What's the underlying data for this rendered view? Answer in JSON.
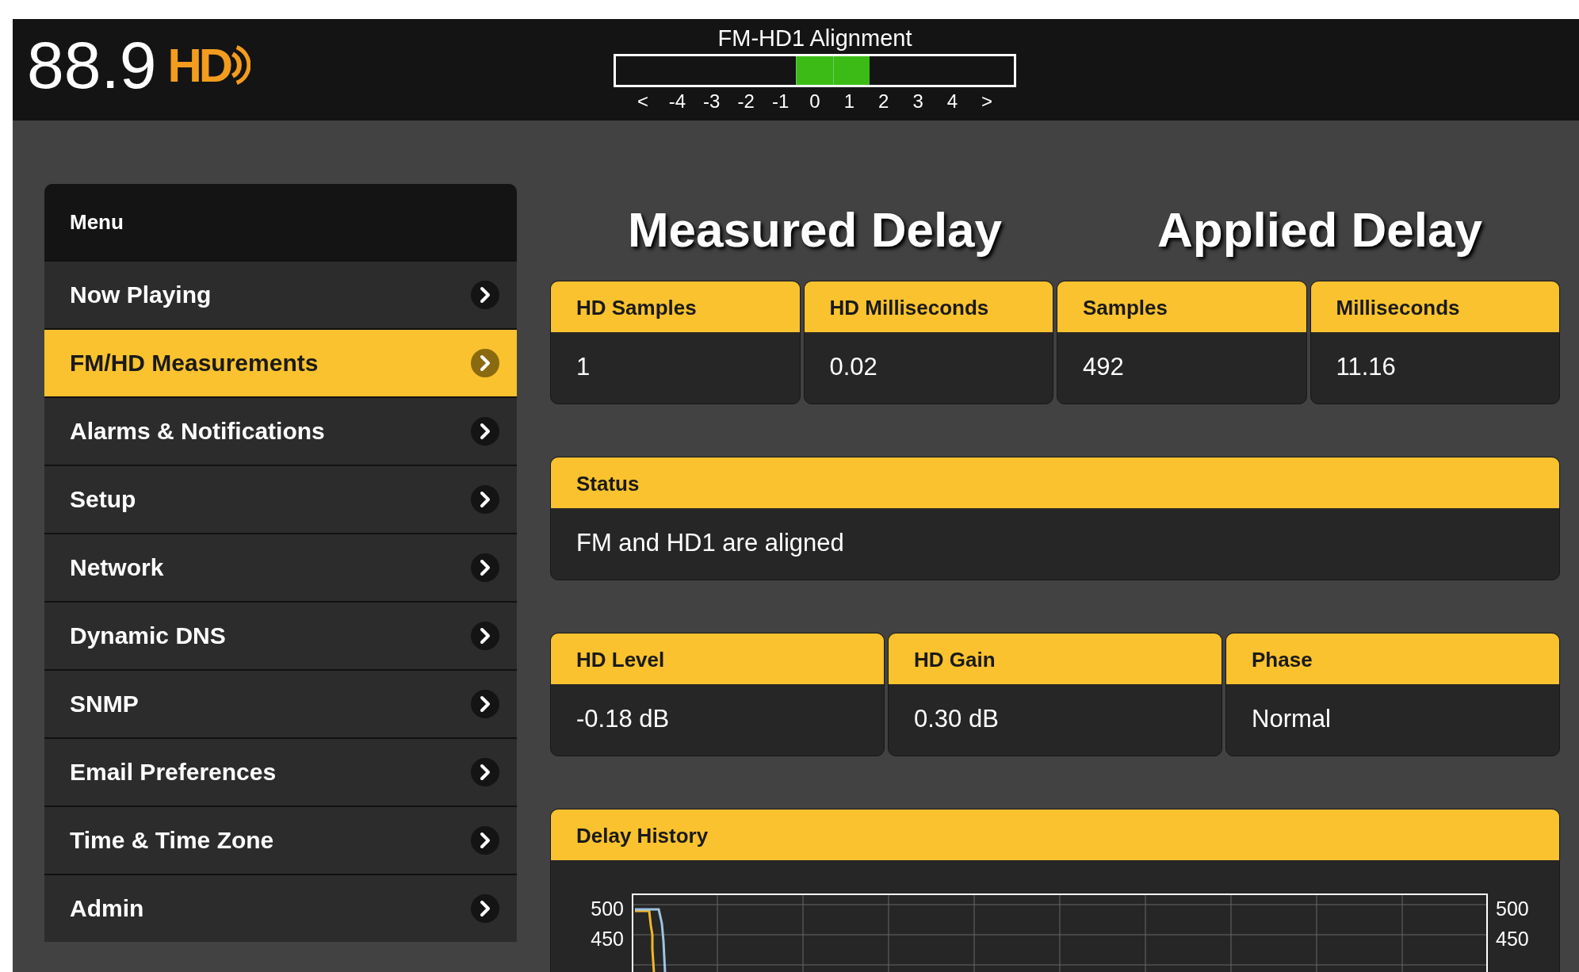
{
  "header": {
    "frequency": "88.9",
    "logo_text": "HD",
    "alignment": {
      "title": "FM-HD1 Alignment",
      "cells": [
        {
          "label": "<",
          "lit": false
        },
        {
          "label": "-4",
          "lit": false
        },
        {
          "label": "-3",
          "lit": false
        },
        {
          "label": "-2",
          "lit": false
        },
        {
          "label": "-1",
          "lit": false
        },
        {
          "label": "0",
          "lit": true
        },
        {
          "label": "1",
          "lit": true
        },
        {
          "label": "2",
          "lit": false
        },
        {
          "label": "3",
          "lit": false
        },
        {
          "label": "4",
          "lit": false
        },
        {
          "label": ">",
          "lit": false
        }
      ]
    }
  },
  "menu": {
    "title": "Menu",
    "items": [
      {
        "label": "Now Playing",
        "selected": false
      },
      {
        "label": "FM/HD Measurements",
        "selected": true
      },
      {
        "label": "Alarms & Notifications",
        "selected": false
      },
      {
        "label": "Setup",
        "selected": false
      },
      {
        "label": "Network",
        "selected": false
      },
      {
        "label": "Dynamic DNS",
        "selected": false
      },
      {
        "label": "SNMP",
        "selected": false
      },
      {
        "label": "Email Preferences",
        "selected": false
      },
      {
        "label": "Time & Time Zone",
        "selected": false
      },
      {
        "label": "Admin",
        "selected": false
      }
    ]
  },
  "headings": [
    "Measured Delay",
    "Applied Delay"
  ],
  "delay_table": {
    "columns": [
      "HD Samples",
      "HD Milliseconds",
      "Samples",
      "Milliseconds"
    ],
    "values": [
      "1",
      "0.02",
      "492",
      "11.16"
    ]
  },
  "status": {
    "title": "Status",
    "text": "FM and HD1 are aligned"
  },
  "level_table": {
    "columns": [
      "HD Level",
      "HD Gain",
      "Phase"
    ],
    "values": [
      "-0.18 dB",
      "0.30 dB",
      "Normal"
    ]
  },
  "delay_history": {
    "title": "Delay History",
    "left_ticks": [
      "500",
      "450"
    ],
    "right_ticks": [
      "500",
      "450"
    ]
  }
}
